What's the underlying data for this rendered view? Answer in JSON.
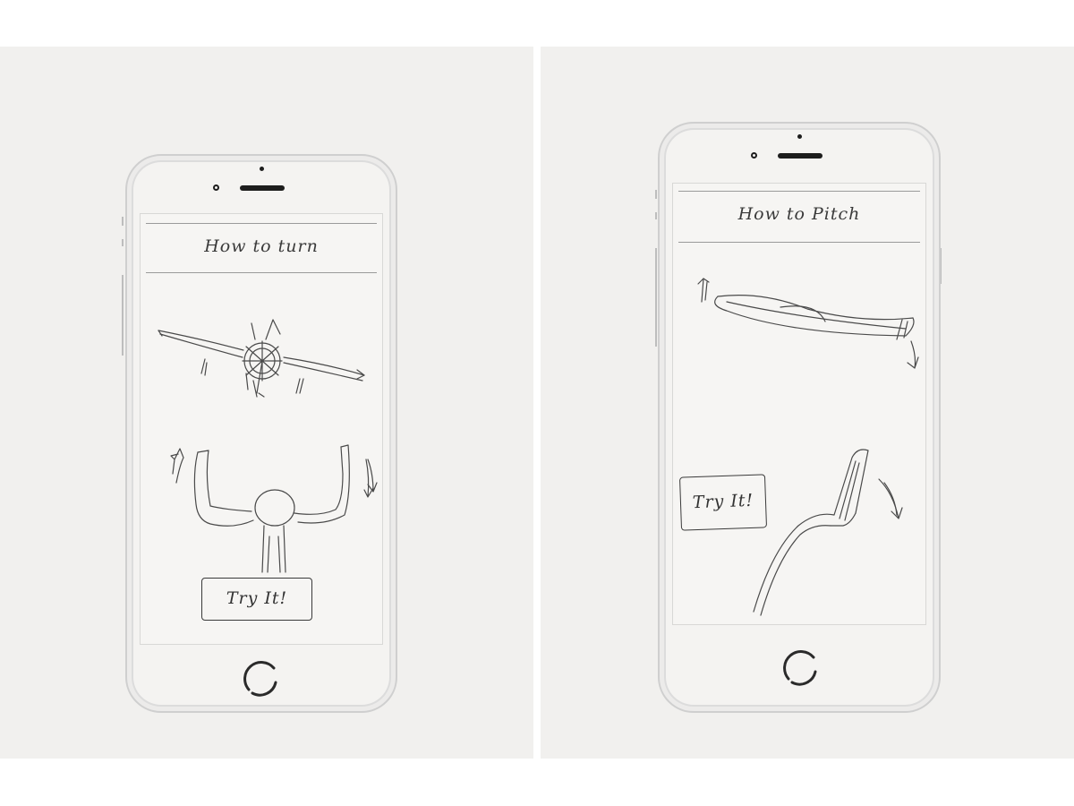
{
  "sketches": [
    {
      "title": "How to turn",
      "button_label": "Try It!"
    },
    {
      "title": "How to Pitch",
      "button_label": "Try It!"
    }
  ]
}
